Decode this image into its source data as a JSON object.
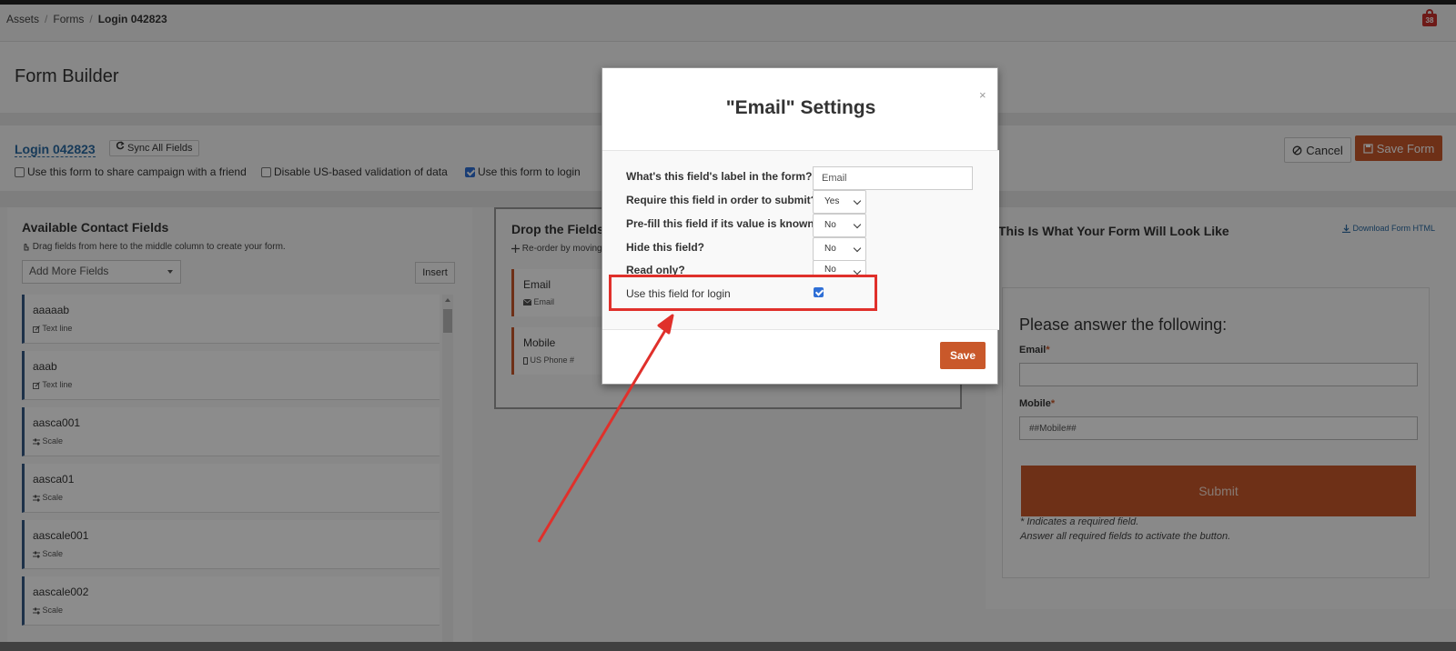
{
  "breadcrumb": {
    "items": [
      "Assets",
      "Forms",
      "Login 042823"
    ],
    "separator": "/"
  },
  "notifications": {
    "count": "38"
  },
  "page_title": "Form Builder",
  "form_bar": {
    "form_name": "Login 042823",
    "sync_label": "Sync All Fields",
    "options": [
      {
        "label": "Use this form to share campaign with a friend",
        "checked": false
      },
      {
        "label": "Disable US-based validation of data",
        "checked": false
      },
      {
        "label": "Use this form to login",
        "checked": true
      }
    ],
    "cancel_label": "Cancel",
    "save_form_label": "Save Form"
  },
  "available": {
    "title": "Available Contact Fields",
    "hint": "Drag fields from here to the middle column to create your form.",
    "add_more_placeholder": "Add More Fields",
    "insert_label": "Insert",
    "fields": [
      {
        "name": "aaaaab",
        "type": "Text line"
      },
      {
        "name": "aaab",
        "type": "Text line"
      },
      {
        "name": "aasca001",
        "type": "Scale"
      },
      {
        "name": "aasca01",
        "type": "Scale"
      },
      {
        "name": "aascale001",
        "type": "Scale"
      },
      {
        "name": "aascale002",
        "type": "Scale"
      }
    ]
  },
  "drop": {
    "title": "Drop the Fields",
    "hint": "Re-order by moving",
    "items": [
      {
        "name": "Email",
        "type": "Email"
      },
      {
        "name": "Mobile",
        "type": "US Phone #"
      }
    ]
  },
  "preview": {
    "title": "This Is What Your Form Will Look Like",
    "download_label": "Download Form HTML",
    "heading": "Please answer the following:",
    "email_label": "Email",
    "mobile_label": "Mobile",
    "required_mark": "*",
    "mobile_value": "##Mobile##",
    "submit_label": "Submit",
    "note_1": "* Indicates a required field.",
    "note_2": "Answer all required fields to activate the button."
  },
  "modal": {
    "title": "\"Email\" Settings",
    "close": "×",
    "label_q": "What's this field's label in the form?",
    "label_value": "Email",
    "require_q": "Require this field in order to submit?",
    "require_value": "Yes",
    "prefill_q": "Pre-fill this field if its value is known?",
    "prefill_value": "No",
    "hide_q": "Hide this field?",
    "hide_value": "No",
    "readonly_q": "Read only?",
    "readonly_value": "No",
    "login_q": "Use this field for login",
    "login_checked": true,
    "save_label": "Save"
  },
  "annotation": {
    "highlight_color": "#e0302b"
  },
  "colors": {
    "accent": "#c9582a",
    "link": "#2a6aa3",
    "field_bar": "#355a86"
  }
}
